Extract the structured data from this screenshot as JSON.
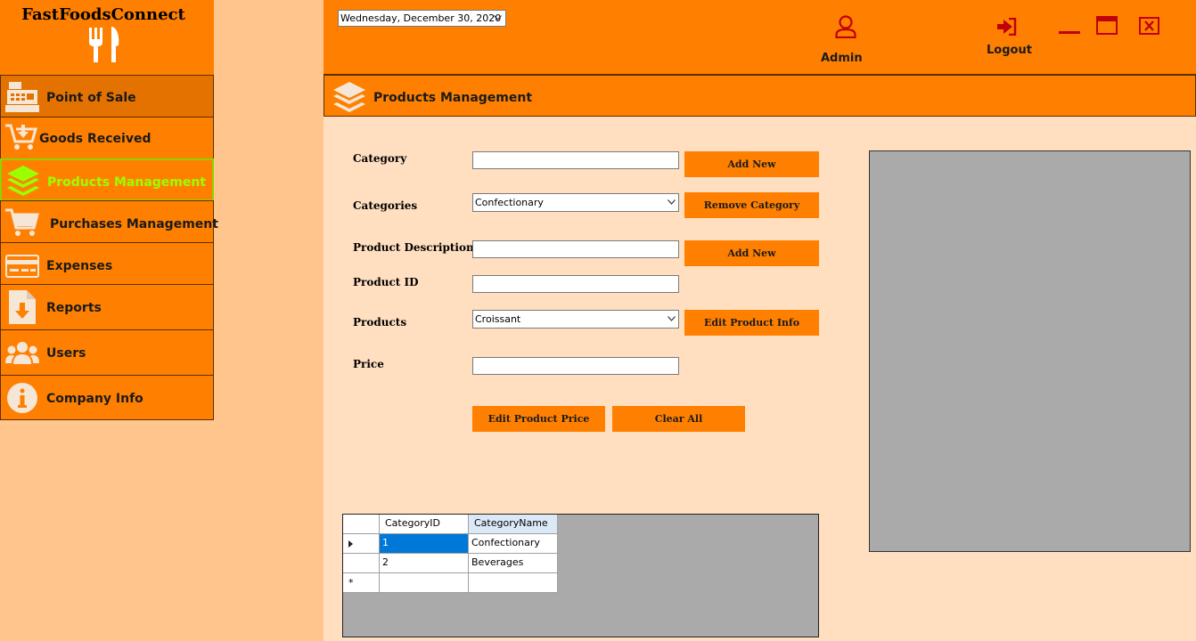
{
  "app": {
    "title": "FastFoodsConnect"
  },
  "sidebar": {
    "items": [
      {
        "label": "Point of Sale",
        "icon": "cash-register-icon"
      },
      {
        "label": "Goods Received",
        "icon": "cart-download-icon"
      },
      {
        "label": "Products Management",
        "icon": "layers-icon",
        "active": true
      },
      {
        "label": "Purchases Management",
        "icon": "shopping-cart-icon"
      },
      {
        "label": "Expenses",
        "icon": "credit-card-icon"
      },
      {
        "label": "Reports",
        "icon": "file-download-icon"
      },
      {
        "label": "Users",
        "icon": "users-icon"
      },
      {
        "label": "Company Info",
        "icon": "info-icon"
      }
    ]
  },
  "header": {
    "date": "Wednesday, December 30, 2020",
    "user_label": "Admin",
    "logout_label": "Logout"
  },
  "section": {
    "title": "Products Management"
  },
  "form": {
    "category_label": "Category",
    "category_value": "",
    "add_new_category": "Add New",
    "categories_label": "Categories",
    "categories_selected": "Confectionary",
    "remove_category": "Remove Category",
    "product_description_label": "Product Description",
    "product_description_value": "",
    "add_new_product": "Add New",
    "product_id_label": "Product ID",
    "product_id_value": "",
    "products_label": "Products",
    "products_selected": "Croissant",
    "edit_product_info": "Edit Product Info",
    "price_label": "Price",
    "price_value": "",
    "edit_product_price": "Edit Product Price",
    "clear_all": "Clear All"
  },
  "grid": {
    "columns": [
      "CategoryID",
      "CategoryName"
    ],
    "rows": [
      [
        "1",
        "Confectionary"
      ],
      [
        "2",
        "Beverages"
      ]
    ]
  },
  "colors": {
    "accent": "#ff8000",
    "sidebar_bg": "#ffc58c",
    "content_bg": "#ffdfc0",
    "active_text": "#9aff00",
    "header_icon": "#c0000a"
  }
}
